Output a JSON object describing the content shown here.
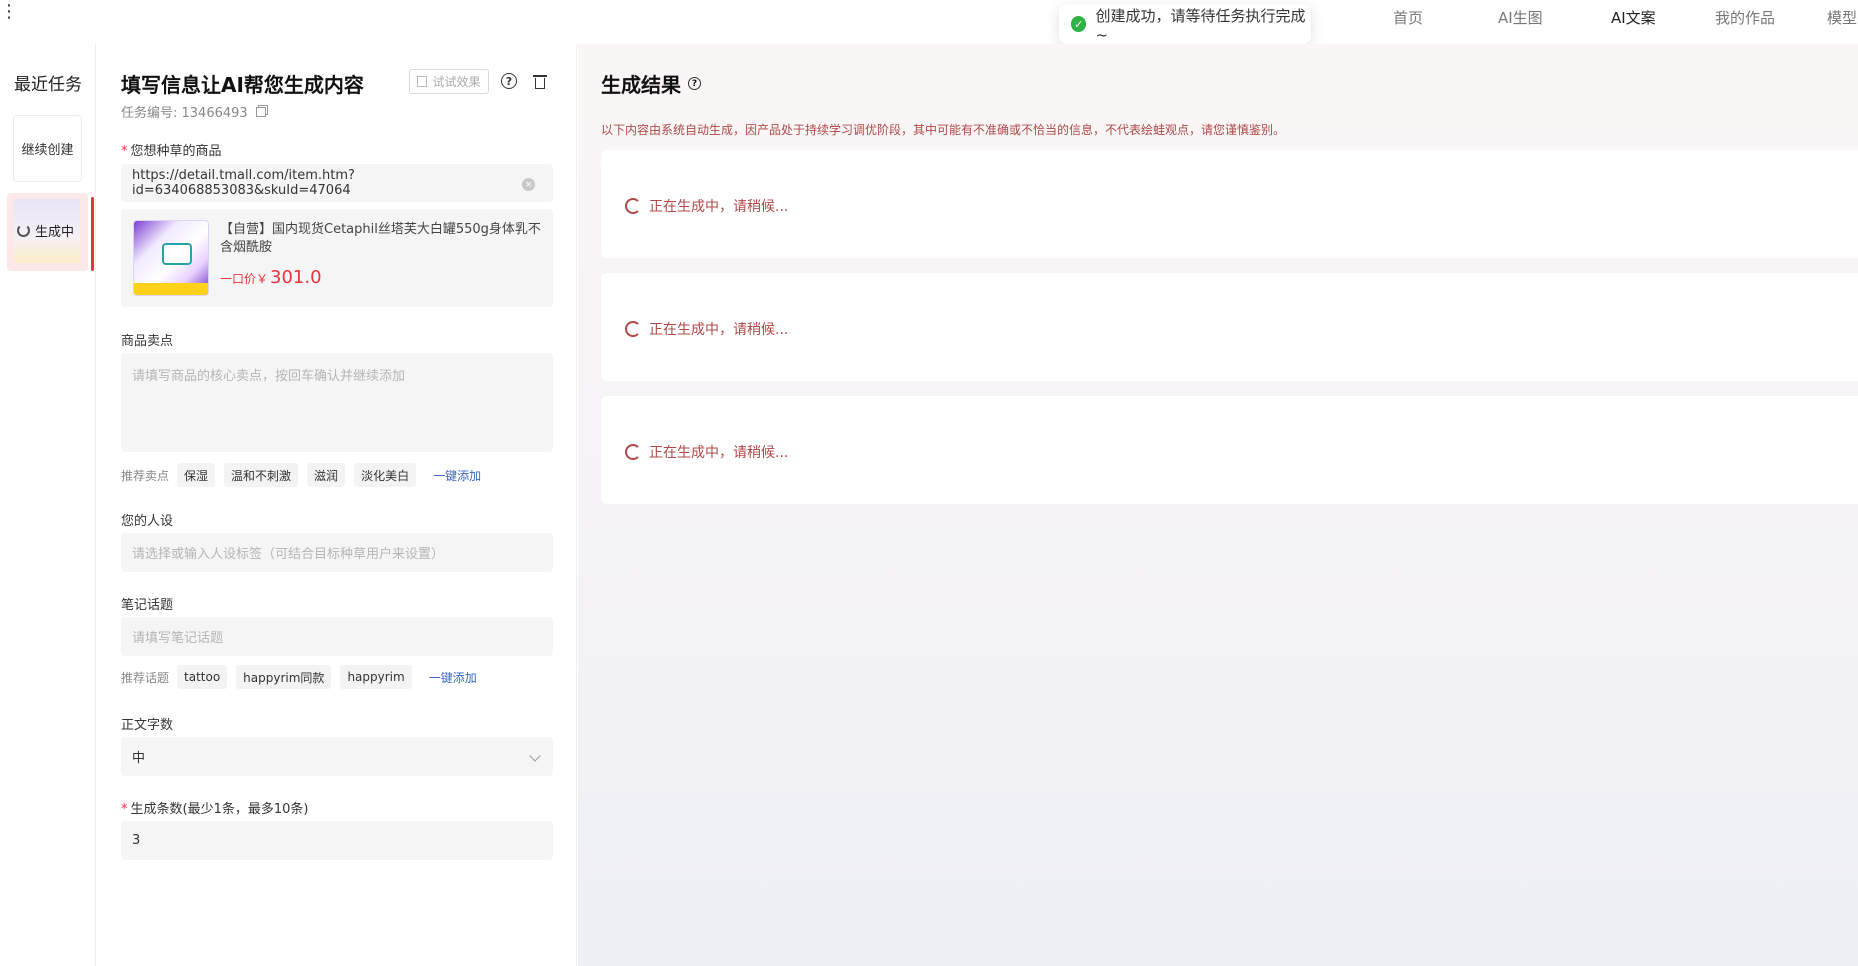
{
  "nav": {
    "items": [
      "首页",
      "AI生图",
      "AI文案",
      "我的作品",
      "模型"
    ],
    "active_index": 2
  },
  "toast": {
    "message": "创建成功，请等待任务执行完成~"
  },
  "recent": {
    "title": "最近任务",
    "continue_label": "继续创建",
    "task_status": "生成中"
  },
  "form": {
    "title": "填写信息让AI帮您生成内容",
    "try_label": "试试效果",
    "task_no": "任务编号: 13466493",
    "product_label": "您想种草的商品",
    "product_url": "https://detail.tmall.com/item.htm?id=634068853083&skuId=47064",
    "product_name": "【自营】国内现货Cetaphil丝塔芙大白罐550g身体乳不含烟酰胺",
    "price_label": "一口价￥",
    "price_value": "301.0",
    "selling_label": "商品卖点",
    "selling_placeholder": "请填写商品的核心卖点，按回车确认并继续添加",
    "selling_rec_label": "推荐卖点",
    "selling_tags": [
      "保湿",
      "温和不刺激",
      "滋润",
      "淡化美白"
    ],
    "add_all": "一键添加",
    "persona_label": "您的人设",
    "persona_placeholder": "请选择或输入人设标签（可结合目标种草用户来设置）",
    "topic_label": "笔记话题",
    "topic_placeholder": "请填写笔记话题",
    "topic_rec_label": "推荐话题",
    "topic_tags": [
      "tattoo",
      "happyrim同款",
      "happyrim"
    ],
    "wordcount_label": "正文字数",
    "wordcount_value": "中",
    "count_label": "生成条数(最少1条，最多10条)",
    "count_value": "3"
  },
  "results": {
    "title": "生成结果",
    "disclaimer": "以下内容由系统自动生成，因产品处于持续学习调优阶段，其中可能有不准确或不恰当的信息，不代表绘蛙观点，请您谨慎鉴别。",
    "status_text": "正在生成中，请稍候..."
  },
  "colors": {
    "accent_red": "#e8343c",
    "status_text": "#b04848",
    "link": "#3b67c4",
    "success": "#2fb344"
  }
}
